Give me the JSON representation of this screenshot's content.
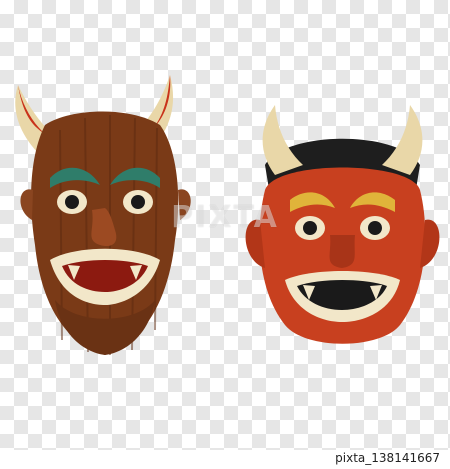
{
  "image": {
    "subject": "two red oni masks with horns",
    "watermark_text": "PIXTA",
    "image_id": "pixta_138141667"
  },
  "colors": {
    "left_mask_wood": "#7a3a17",
    "right_mask_red": "#c8401f",
    "horn": "#e9d7a8",
    "horn_tip_left": "#c9331a",
    "eyebrow_green": "#2f7d6a",
    "teeth": "#f2e7c9"
  }
}
